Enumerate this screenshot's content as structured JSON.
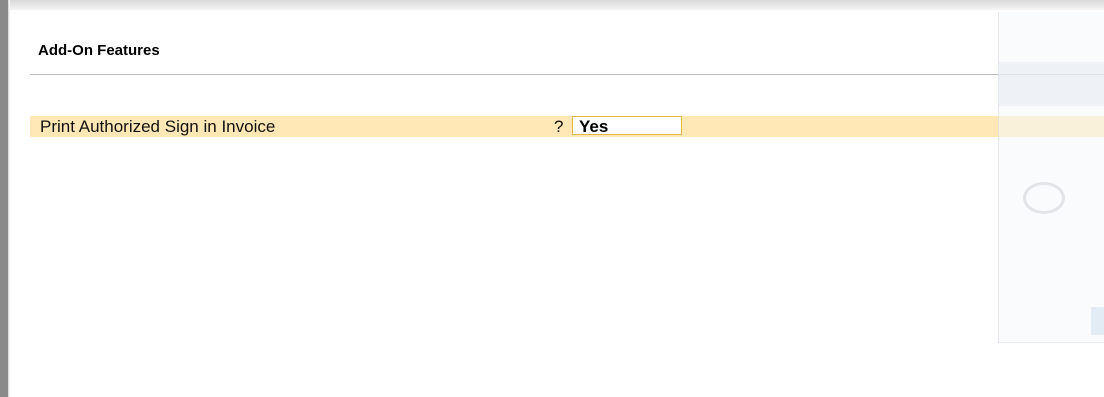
{
  "panel": {
    "title": "Add-On Features"
  },
  "feature": {
    "label": "Print Authorized Sign in Invoice",
    "question": "?",
    "value": "Yes"
  },
  "colors": {
    "highlight": "#ffe8b5",
    "field_border": "#e6b84c"
  }
}
